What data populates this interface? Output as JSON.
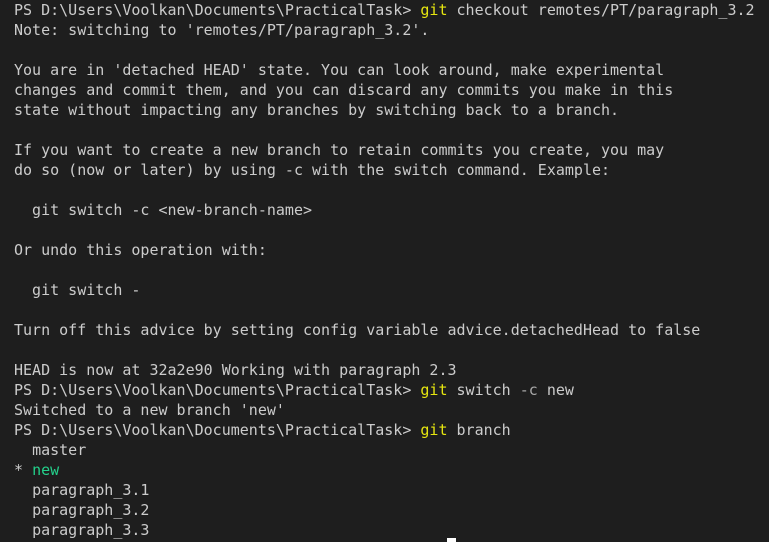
{
  "colors": {
    "background": "#1e1e1e",
    "text": "#cccccc",
    "command": "#e5e510",
    "current_branch": "#23d18b"
  },
  "terminal": {
    "prompt": "PS D:\\Users\\Voolkan\\Documents\\PracticalTask>",
    "cmd1": {
      "name": "git",
      "args": "checkout remotes/PT/paragraph_3.2"
    },
    "out1": "Note: switching to 'remotes/PT/paragraph_3.2'.",
    "advice": [
      "You are in 'detached HEAD' state. You can look around, make experimental",
      "changes and commit them, and you can discard any commits you make in this",
      "state without impacting any branches by switching back to a branch.",
      "If you want to create a new branch to retain commits you create, you may",
      "do so (now or later) by using -c with the switch command. Example:",
      "  git switch -c <new-branch-name>",
      "Or undo this operation with:",
      "  git switch -",
      "Turn off this advice by setting config variable advice.detachedHead to false",
      "HEAD is now at 32a2e90 Working with paragraph 2.3"
    ],
    "cmd2": {
      "name": "git",
      "subcommand": "switch",
      "flag": "-c",
      "value": "new"
    },
    "out2": "Switched to a new branch 'new'",
    "cmd3": {
      "name": "git",
      "args": "branch"
    },
    "branches": {
      "master": "master",
      "current_marker": "*",
      "current": "new",
      "b1": "paragraph_3.1",
      "b2": "paragraph_3.2",
      "b3": "paragraph_3.3"
    }
  }
}
